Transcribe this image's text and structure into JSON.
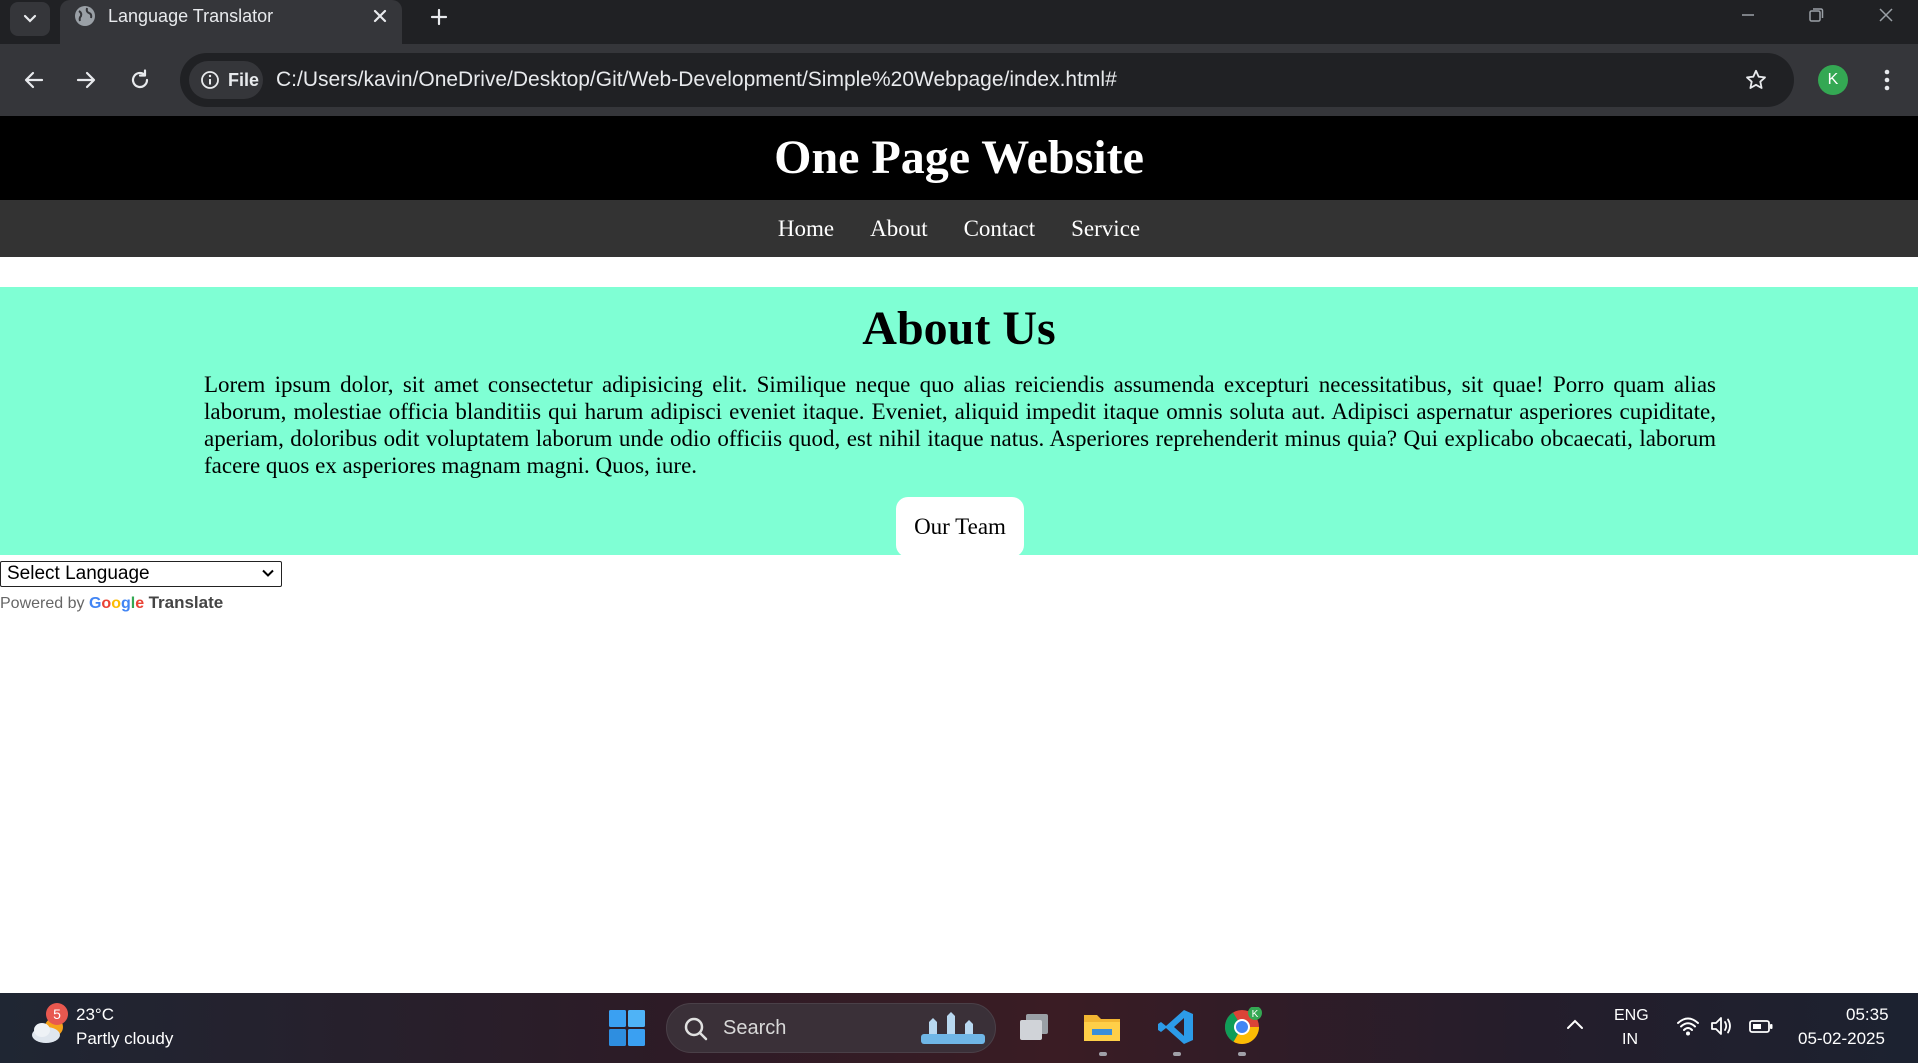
{
  "browser": {
    "tab_title": "Language Translator",
    "chip_label": "File",
    "url": "C:/Users/kavin/OneDrive/Desktop/Git/Web-Development/Simple%20Webpage/index.html#",
    "profile_initial": "K"
  },
  "page": {
    "site_title": "One Page Website",
    "nav": [
      "Home",
      "About",
      "Contact",
      "Service"
    ],
    "about_title": "About Us",
    "about_text": "Lorem ipsum dolor, sit amet consectetur adipisicing elit. Similique neque quo alias reiciendis assumenda excepturi necessitatibus, sit quae! Porro quam alias laborum, molestiae officia blanditiis qui harum adipisci eveniet itaque. Eveniet, aliquid impedit itaque omnis soluta aut. Adipisci aspernatur asperiores cupiditate, aperiam, doloribus odit voluptatem laborum unde odio officiis quod, est nihil itaque natus. Asperiores reprehenderit minus quia? Qui explicabo obcaecati, laborum facere quos ex asperiores magnam magni. Quos, iure.",
    "team_button": "Our Team",
    "translate": {
      "select_label": "Select Language",
      "powered_by": "Powered by",
      "google": "Google",
      "translate_word": "Translate"
    }
  },
  "taskbar": {
    "weather_badge": "5",
    "temperature": "23°C",
    "weather": "Partly cloudy",
    "search_placeholder": "Search",
    "lang_line1": "ENG",
    "lang_line2": "IN",
    "time": "05:35",
    "date": "05-02-2025",
    "chrome_badge": "K"
  },
  "colors": {
    "header_bg": "#000000",
    "nav_bg": "#333333",
    "about_bg": "#7fffd4",
    "chrome_dark": "#202124",
    "chrome_toolbar": "#35363a"
  }
}
